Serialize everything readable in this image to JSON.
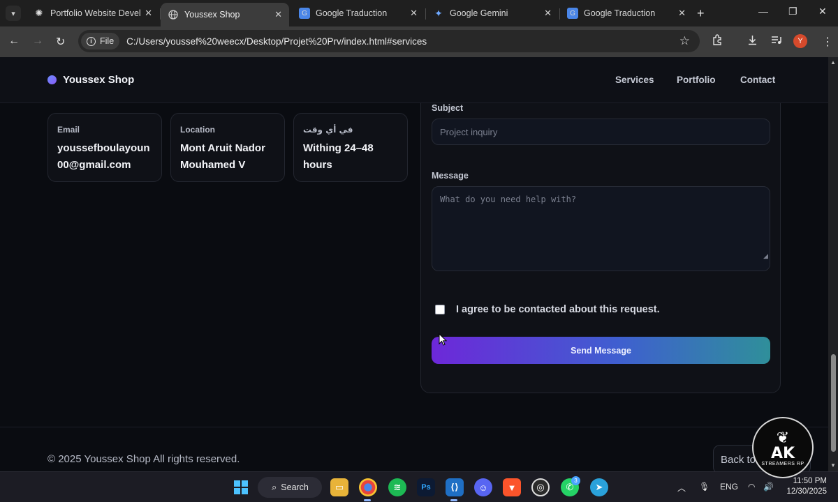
{
  "browser": {
    "tabs": [
      {
        "title": "Portfolio Website Develop",
        "icon": "openai-icon",
        "active": false
      },
      {
        "title": "Youssex Shop",
        "icon": "globe-icon",
        "active": true
      },
      {
        "title": "Google Traduction",
        "icon": "google-translate-icon",
        "active": false
      },
      {
        "title": "Google Gemini",
        "icon": "gemini-icon",
        "active": false
      },
      {
        "title": "Google Traduction",
        "icon": "google-translate-icon",
        "active": false
      }
    ],
    "address": {
      "chip_label": "File",
      "url": "C:/Users/youssef%20weecx/Desktop/Projet%20Prv/index.html#services"
    },
    "profile_initial": "Y"
  },
  "site": {
    "brand": "Youssex Shop",
    "nav": [
      "Services",
      "Portfolio",
      "Contact"
    ],
    "info_cards": [
      {
        "label": "Email",
        "value": "youssefboulayoun00@gmail.com"
      },
      {
        "label": "Location",
        "value": "Mont Aruit Nador Mouhamed V"
      },
      {
        "label": "في أي وقت",
        "value": "Withing 24–48 hours"
      }
    ],
    "form": {
      "subject_label": "Subject",
      "subject_placeholder": "Project inquiry",
      "message_label": "Message",
      "message_placeholder": "What do you need help with?",
      "agree_text": "I agree to be contacted about this request.",
      "agree_checked": false,
      "submit_label": "Send Message"
    },
    "footer": {
      "copyright": "© 2025 Youssex Shop All rights reserved.",
      "back_to_top": "Back to top"
    }
  },
  "overlay_logo": {
    "text": "AK",
    "subtext": "STREAMERS RP"
  },
  "taskbar": {
    "search_label": "Search",
    "apps": [
      "start-icon",
      "file-explorer-icon",
      "chrome-icon",
      "spotify-icon",
      "photoshop-icon",
      "vscode-icon",
      "discord-icon",
      "brave-icon",
      "obs-icon",
      "whatsapp-icon",
      "telegram-icon"
    ],
    "whatsapp_badge": "3",
    "photoshop_label": "Ps",
    "language": "ENG",
    "time": "11:50 PM",
    "date": "12/30/2025"
  }
}
